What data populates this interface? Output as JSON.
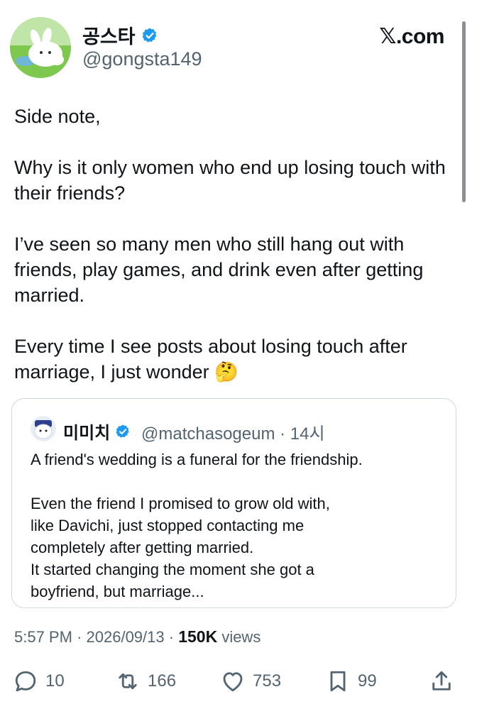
{
  "author": {
    "display_name": "공스타",
    "handle": "@gongsta149",
    "verified": true,
    "avatar_icon": "bunny-avatar"
  },
  "brand": "𝕏.com",
  "tweet": {
    "paragraphs": [
      "Side note,",
      "Why is it only women who end up losing touch with their friends?",
      "I’ve seen so many men who still hang out with friends, play games, and drink even after getting married.",
      "Every time I see posts about losing touch after marriage, I just wonder 🤔"
    ]
  },
  "quote": {
    "display_name": "미미치",
    "handle": "@matchasogeum",
    "separator": "·",
    "time": "14시",
    "verified": true,
    "avatar_icon": "character-avatar",
    "lines": [
      "A friend's wedding is a funeral for the friendship.",
      "Even the friend I promised to grow old with,",
      "like Davichi, just stopped contacting me",
      "completely after getting married.",
      "It started changing the moment she got a",
      "boyfriend, but marriage..."
    ]
  },
  "meta": {
    "time": "5:57 PM",
    "dot": "·",
    "date": "2026/09/13",
    "views_count": "150K",
    "views_label": "views"
  },
  "actions": {
    "replies": "10",
    "reposts": "166",
    "likes": "753",
    "bookmarks": "99"
  },
  "colors": {
    "verified_blue": "#1d9bf0",
    "text_primary": "#0f1419",
    "text_secondary": "#536471",
    "border": "#cfd9de"
  }
}
